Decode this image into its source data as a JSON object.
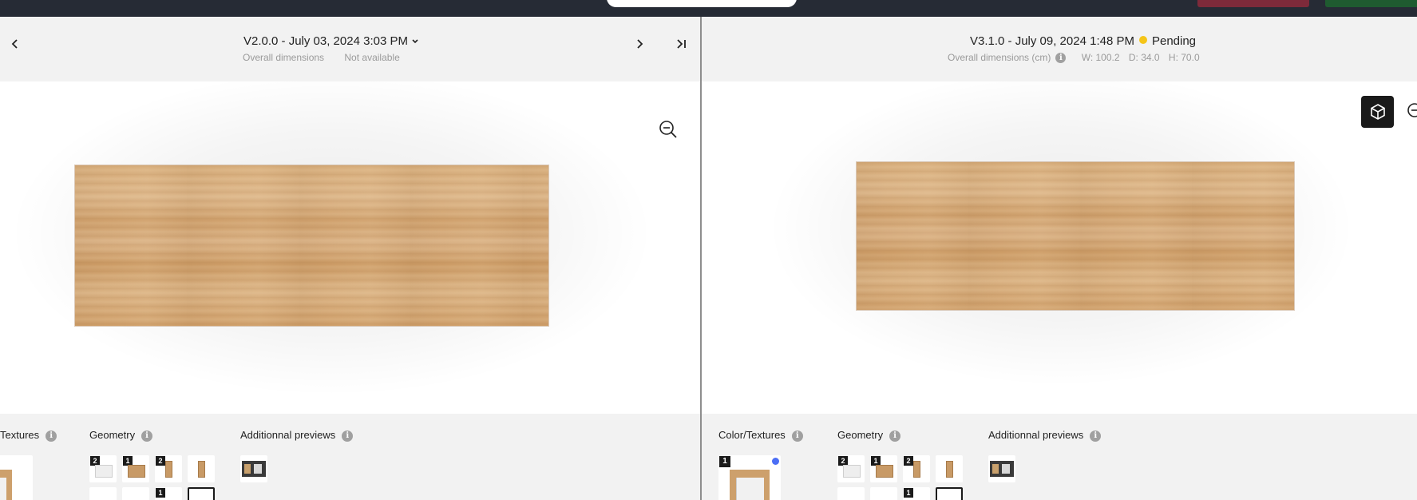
{
  "colors": {
    "topbar": "#262b35",
    "pending_dot": "#f5c518",
    "selected_dot": "#4c6ef5",
    "dark_button": "#1a1a1a"
  },
  "left_panel": {
    "version_title": "V2.0.0 - July 03, 2024 3:03 PM",
    "dimensions_label": "Overall dimensions",
    "dimensions_value": "Not available",
    "nav": {
      "prev_icon": "chevron-left-icon",
      "next_icon": "chevron-right-icon",
      "last_icon": "skip-to-last-icon"
    },
    "zoom_icon": "zoom-out-icon",
    "sections": {
      "textures_label": "Textures",
      "geometry_label": "Geometry",
      "previews_label": "Additionnal previews"
    },
    "geometry_badges": [
      "2",
      "1",
      "2",
      "",
      "1"
    ]
  },
  "right_panel": {
    "version_title": "V3.1.0 - July 09, 2024 1:48 PM",
    "status": "Pending",
    "dimensions_label": "Overall dimensions (cm)",
    "width": "W: 100.2",
    "depth": "D: 34.0",
    "height": "H: 70.0",
    "view_toggle_icon": "cube-icon",
    "zoom_icon": "zoom-out-icon",
    "sections": {
      "textures_label": "Color/Textures",
      "geometry_label": "Geometry",
      "previews_label": "Additionnal previews"
    },
    "color_badge": "1",
    "geometry_badges": [
      "2",
      "1",
      "2",
      "",
      "1"
    ]
  },
  "info_glyph": "i"
}
